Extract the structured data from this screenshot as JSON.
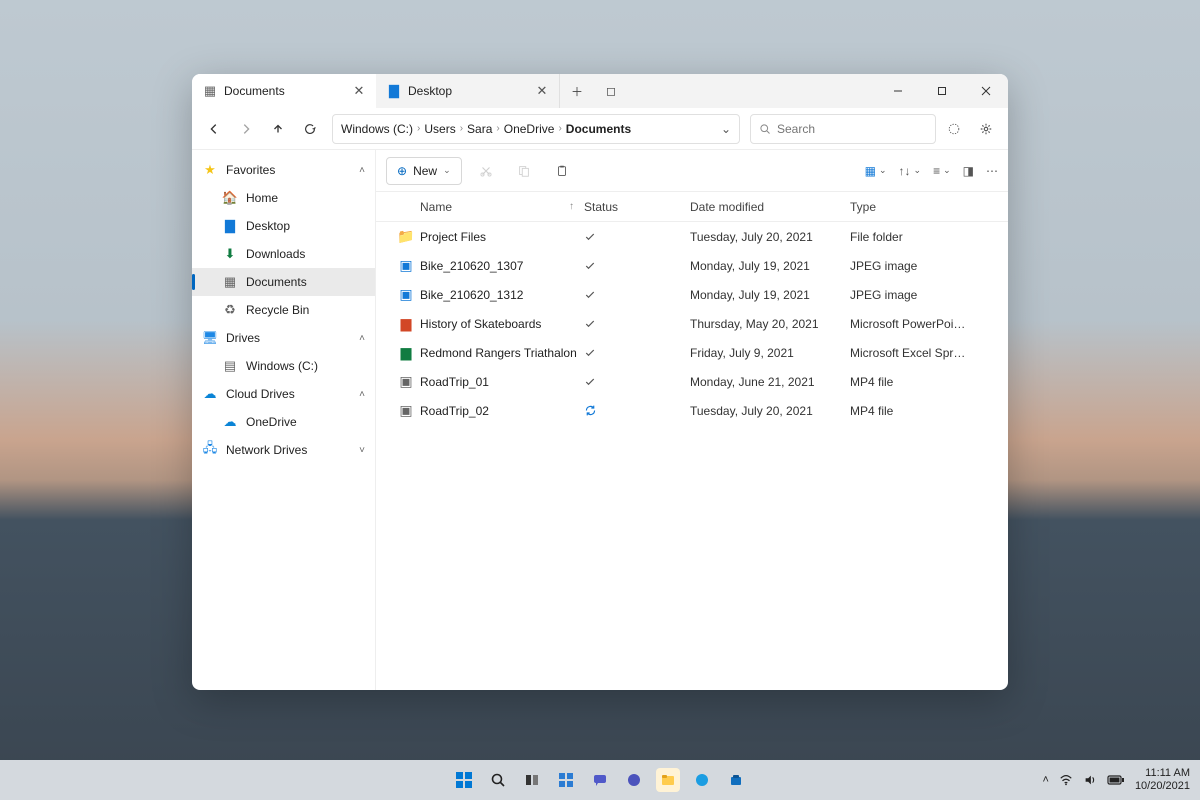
{
  "tabs": [
    {
      "label": "Documents",
      "active": true
    },
    {
      "label": "Desktop",
      "active": false
    }
  ],
  "breadcrumb": [
    "Windows (C:)",
    "Users",
    "Sara",
    "OneDrive",
    "Documents"
  ],
  "search": {
    "placeholder": "Search"
  },
  "toolbar": {
    "new_label": "New"
  },
  "sidebar": {
    "favorites": {
      "header": "Favorites",
      "items": [
        "Home",
        "Desktop",
        "Downloads",
        "Documents",
        "Recycle Bin"
      ]
    },
    "drives": {
      "header": "Drives",
      "items": [
        "Windows (C:)"
      ]
    },
    "cloud": {
      "header": "Cloud Drives",
      "items": [
        "OneDrive"
      ]
    },
    "network": {
      "header": "Network Drives"
    }
  },
  "columns": {
    "name": "Name",
    "status": "Status",
    "date": "Date modified",
    "type": "Type"
  },
  "files": [
    {
      "name": "Project Files",
      "status": "check",
      "date": "Tuesday, July 20, 2021",
      "type": "File folder",
      "kind": "folder"
    },
    {
      "name": "Bike_210620_1307",
      "status": "check",
      "date": "Monday, July 19, 2021",
      "type": "JPEG image",
      "kind": "image"
    },
    {
      "name": "Bike_210620_1312",
      "status": "check",
      "date": "Monday, July 19, 2021",
      "type": "JPEG image",
      "kind": "image"
    },
    {
      "name": "History of Skateboards",
      "status": "check",
      "date": "Thursday, May 20, 2021",
      "type": "Microsoft PowerPoi…",
      "kind": "ppt"
    },
    {
      "name": "Redmond Rangers Triathalon",
      "status": "check",
      "date": "Friday, July 9, 2021",
      "type": "Microsoft Excel Spr…",
      "kind": "xls"
    },
    {
      "name": "RoadTrip_01",
      "status": "check",
      "date": "Monday, June 21, 2021",
      "type": "MP4 file",
      "kind": "video"
    },
    {
      "name": "RoadTrip_02",
      "status": "sync",
      "date": "Tuesday, July 20, 2021",
      "type": "MP4 file",
      "kind": "video"
    }
  ],
  "systray": {
    "time": "11:11 AM",
    "date": "10/20/2021"
  }
}
